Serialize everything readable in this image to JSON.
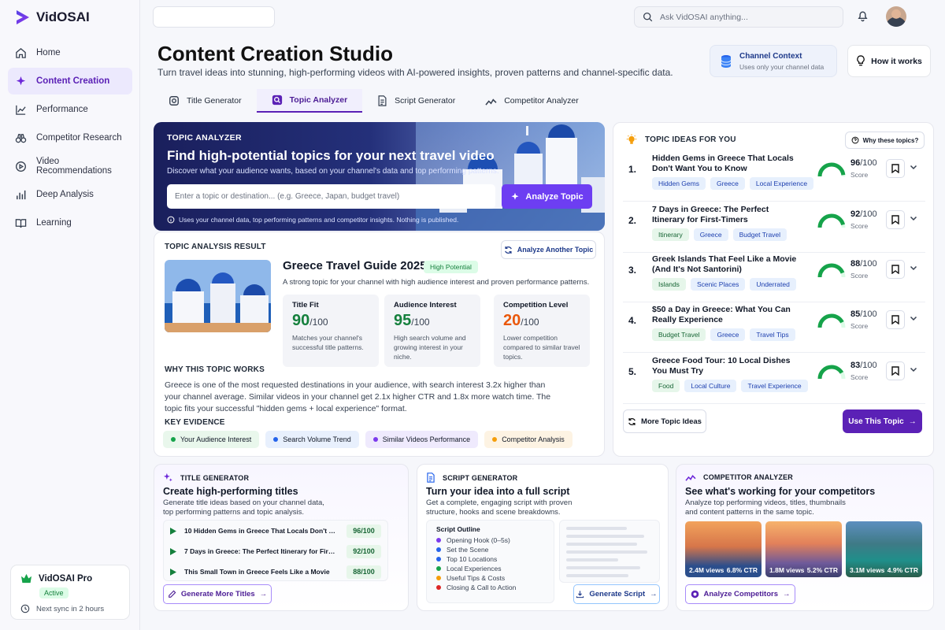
{
  "app": {
    "name": "VidOSAI"
  },
  "sidebar": {
    "items": [
      {
        "label": "Home"
      },
      {
        "label": "Content Creation"
      },
      {
        "label": "Performance"
      },
      {
        "label": "Competitor Research"
      },
      {
        "label": "Video Recommendations"
      },
      {
        "label": "Deep Analysis"
      },
      {
        "label": "Learning"
      }
    ],
    "pro": {
      "title": "VidOSAI Pro",
      "status": "Active",
      "sync": "Next sync in 2 hours"
    }
  },
  "topbar": {
    "search_placeholder": "Ask VidOSAI anything..."
  },
  "header": {
    "title": "Content Creation Studio",
    "subtitle": "Turn travel ideas into stunning, high-performing videos with AI-powered insights, proven patterns and channel-specific data.",
    "context_title": "Channel Context",
    "context_sub": "Uses only your channel data",
    "how_label": "How it works"
  },
  "tabs": [
    {
      "label": "Title Generator"
    },
    {
      "label": "Topic Analyzer"
    },
    {
      "label": "Script Generator"
    },
    {
      "label": "Competitor Analyzer"
    }
  ],
  "hero": {
    "kicker": "TOPIC ANALYZER",
    "title": "Find high-potential topics for your next travel video",
    "subtitle": "Discover what your audience wants, based on your channel's data and top performing patterns.",
    "input_placeholder": "Enter a topic or destination... (e.g. Greece, Japan, budget travel)",
    "button": "Analyze Topic",
    "note": "Uses your channel data, top performing patterns and competitor insights. Nothing is published."
  },
  "result": {
    "label": "TOPIC ANALYSIS RESULT",
    "another": "Analyze Another Topic",
    "name": "Greece Travel Guide 2025",
    "badge": "High Potential",
    "desc": "A strong topic for your channel with high audience interest and proven performance patterns.",
    "metrics": [
      {
        "title": "Title Fit",
        "value": "90",
        "max": "/100",
        "color": "#15803d",
        "desc": "Matches your channel's successful title patterns."
      },
      {
        "title": "Audience Interest",
        "value": "95",
        "max": "/100",
        "color": "#15803d",
        "desc": "High search volume and growing interest in your niche."
      },
      {
        "title": "Competition Level",
        "value": "20",
        "max": "/100",
        "color": "#ea580c",
        "desc": "Lower competition compared to similar travel topics."
      }
    ],
    "why_label": "WHY THIS TOPIC WORKS",
    "why_text": "Greece is one of the most requested destinations in your audience, with search interest 3.2x higher than your channel average. Similar videos in your channel get 2.1x higher CTR and 1.8x more watch time. The topic fits your successful \"hidden gems + local experience\" format.",
    "evidence_label": "KEY EVIDENCE",
    "evidence": [
      {
        "label": "Your Audience Interest",
        "color": "#16a34a",
        "bg": "#e9f7ec"
      },
      {
        "label": "Search Volume Trend",
        "color": "#2563eb",
        "bg": "#e8f0fd"
      },
      {
        "label": "Similar Videos Performance",
        "color": "#7c3aed",
        "bg": "#efeafd"
      },
      {
        "label": "Competitor Analysis",
        "color": "#f59e0b",
        "bg": "#fdf3e3"
      }
    ]
  },
  "ideas": {
    "label": "TOPIC IDEAS FOR YOU",
    "why_btn": "Why these topics?",
    "score_label": "Score",
    "items": [
      {
        "num": "1.",
        "title": "Hidden Gems in Greece That Locals Don't Want You to Know",
        "score": "96",
        "max": "/100",
        "tags": [
          {
            "t": "Hidden Gems",
            "bg": "#e7f0fd",
            "c": "#1e40af"
          },
          {
            "t": "Greece",
            "bg": "#e7f0fd",
            "c": "#1e40af"
          },
          {
            "t": "Local Experience",
            "bg": "#e7f0fd",
            "c": "#1e40af"
          }
        ]
      },
      {
        "num": "2.",
        "title": "7 Days in Greece: The Perfect Itinerary for First-Timers",
        "score": "92",
        "max": "/100",
        "tags": [
          {
            "t": "Itinerary",
            "bg": "#e6f6ea",
            "c": "#166534"
          },
          {
            "t": "Greece",
            "bg": "#e7f0fd",
            "c": "#1e40af"
          },
          {
            "t": "Budget Travel",
            "bg": "#e7f0fd",
            "c": "#1e40af"
          }
        ]
      },
      {
        "num": "3.",
        "title": "Greek Islands That Feel Like a Movie (And It's Not Santorini)",
        "score": "88",
        "max": "/100",
        "tags": [
          {
            "t": "Islands",
            "bg": "#e6f6ea",
            "c": "#166534"
          },
          {
            "t": "Scenic Places",
            "bg": "#e7f0fd",
            "c": "#1e40af"
          },
          {
            "t": "Underrated",
            "bg": "#e7f0fd",
            "c": "#1e40af"
          }
        ]
      },
      {
        "num": "4.",
        "title": "$50 a Day in Greece: What You Can Really Experience",
        "score": "85",
        "max": "/100",
        "tags": [
          {
            "t": "Budget Travel",
            "bg": "#e6f6ea",
            "c": "#166534"
          },
          {
            "t": "Greece",
            "bg": "#e7f0fd",
            "c": "#1e40af"
          },
          {
            "t": "Travel Tips",
            "bg": "#e7f0fd",
            "c": "#1e40af"
          }
        ]
      },
      {
        "num": "5.",
        "title": "Greece Food Tour: 10 Local Dishes You Must Try",
        "score": "83",
        "max": "/100",
        "tags": [
          {
            "t": "Food",
            "bg": "#e6f6ea",
            "c": "#166534"
          },
          {
            "t": "Local Culture",
            "bg": "#e7f0fd",
            "c": "#1e40af"
          },
          {
            "t": "Travel Experience",
            "bg": "#e7f0fd",
            "c": "#1e40af"
          }
        ]
      }
    ],
    "more": "More Topic Ideas",
    "use": "Use This Topic"
  },
  "title_card": {
    "kicker": "TITLE GENERATOR",
    "title": "Create high-performing titles",
    "sub": "Generate title ideas based on your channel data, top performing patterns and topic analysis.",
    "rows": [
      {
        "text": "10 Hidden Gems in Greece That Locals Don't Want...",
        "score": "96/100"
      },
      {
        "text": "7 Days in Greece: The Perfect Itinerary for First-...",
        "score": "92/100"
      },
      {
        "text": "This Small Town in Greece Feels Like a Movie",
        "score": "88/100"
      }
    ],
    "button": "Generate More Titles"
  },
  "script_card": {
    "kicker": "SCRIPT GENERATOR",
    "title": "Turn your idea into a full script",
    "sub": "Get a complete, engaging script with proven structure, hooks and scene breakdowns.",
    "outline_title": "Script Outline",
    "outline": [
      {
        "t": "Opening Hook (0–5s)",
        "c": "#7c3aed"
      },
      {
        "t": "Set the Scene",
        "c": "#2563eb"
      },
      {
        "t": "Top 10 Locations",
        "c": "#2563eb"
      },
      {
        "t": "Local Experiences",
        "c": "#16a34a"
      },
      {
        "t": "Useful Tips & Costs",
        "c": "#f59e0b"
      },
      {
        "t": "Closing & Call to Action",
        "c": "#dc2626"
      }
    ],
    "button": "Generate Script"
  },
  "comp_card": {
    "kicker": "COMPETITOR ANALYZER",
    "title": "See what's working for your competitors",
    "sub": "Analyze top performing videos, titles, thumbnails and content patterns in the same topic.",
    "thumbs": [
      {
        "views": "2.4M views",
        "ctr": "6.8% CTR"
      },
      {
        "views": "1.8M views",
        "ctr": "5.2% CTR"
      },
      {
        "views": "3.1M views",
        "ctr": "4.9% CTR"
      }
    ],
    "button": "Analyze Competitors"
  }
}
